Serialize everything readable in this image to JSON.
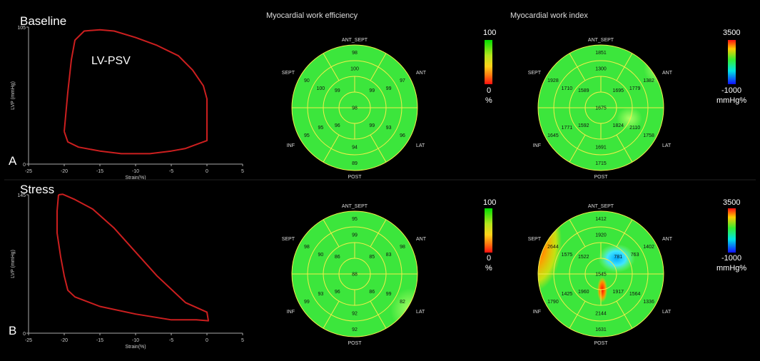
{
  "rows": [
    {
      "row_label": "A",
      "title": "Baseline",
      "annotation": "LV-PSV"
    },
    {
      "row_label": "B",
      "title": "Stress",
      "annotation": ""
    }
  ],
  "column_titles": {
    "efficiency": "Myocardial work efficiency",
    "index": "Myocardial work index"
  },
  "segment_labels": {
    "top": "ANT_SEPT",
    "upper_left": "SEPT",
    "upper_right": "ANT",
    "lower_left": "INF",
    "lower_right": "LAT",
    "bottom": "POST"
  },
  "scales": {
    "efficiency": {
      "max": "100",
      "min": "0",
      "unit": "%"
    },
    "index": {
      "max": "3500",
      "min": "-1000",
      "unit": "mmHg%"
    }
  },
  "colors": {
    "background": "#000000",
    "loop": "#cc1f1f",
    "bullseye_green": "#3ce63c",
    "bullseye_lines": "#f2ee4a",
    "axis": "#aaaaaa"
  },
  "chart_data": [
    {
      "type": "line",
      "panel": "A",
      "title": "Baseline",
      "xlabel": "Strain(%)",
      "ylabel": "LVP (mmHg)",
      "xlim": [
        -25,
        5
      ],
      "ylim": [
        0,
        105
      ],
      "xticks": [
        "-25",
        "-20",
        "-15",
        "-10",
        "-5",
        "0",
        "5"
      ],
      "yticks": [
        "0",
        "105"
      ],
      "series": [
        {
          "points": [
            [
              -20,
              25
            ],
            [
              -19.5,
              55
            ],
            [
              -19,
              80
            ],
            [
              -18.5,
              95
            ],
            [
              -17.2,
              102
            ],
            [
              -15,
              103
            ],
            [
              -13,
              102
            ],
            [
              -10,
              97
            ],
            [
              -7,
              91
            ],
            [
              -4,
              83
            ],
            [
              -2,
              72
            ],
            [
              -0.5,
              60
            ],
            [
              0,
              50
            ],
            [
              0,
              30
            ],
            [
              0,
              18
            ],
            [
              -1,
              16
            ],
            [
              -3,
              12
            ],
            [
              -5,
              10
            ],
            [
              -8,
              8
            ],
            [
              -12,
              8
            ],
            [
              -15,
              10
            ],
            [
              -18,
              13
            ],
            [
              -19.5,
              17
            ],
            [
              -20,
              25
            ]
          ]
        }
      ]
    },
    {
      "type": "line",
      "panel": "B",
      "title": "Stress",
      "xlabel": "Strain(%)",
      "ylabel": "LVP (mmHg)",
      "xlim": [
        -25,
        5
      ],
      "ylim": [
        0,
        145
      ],
      "xticks": [
        "-25",
        "-20",
        "-15",
        "-10",
        "-5",
        "0",
        "5"
      ],
      "yticks": [
        "0",
        "145"
      ],
      "series": [
        {
          "points": [
            [
              -20.8,
              145
            ],
            [
              -21,
              128
            ],
            [
              -21,
              105
            ],
            [
              -20.5,
              80
            ],
            [
              -20,
              60
            ],
            [
              -19.5,
              45
            ],
            [
              -18.5,
              38
            ],
            [
              -15,
              28
            ],
            [
              -10,
              20
            ],
            [
              -5,
              14
            ],
            [
              -1.5,
              14
            ],
            [
              0.2,
              13
            ],
            [
              0,
              22
            ],
            [
              -3,
              32
            ],
            [
              -7,
              60
            ],
            [
              -10,
              85
            ],
            [
              -13,
              110
            ],
            [
              -16,
              130
            ],
            [
              -18.5,
              140
            ],
            [
              -20.2,
              145.5
            ],
            [
              -20.8,
              145
            ]
          ]
        }
      ]
    },
    {
      "type": "heatmap",
      "panel": "A",
      "title": "Myocardial work efficiency",
      "unit": "%",
      "segments": {
        "basal": [
          "98",
          "97",
          "96",
          "89",
          "95",
          "90"
        ],
        "mid": [
          "100",
          "99",
          "93",
          "94",
          "95",
          "100"
        ],
        "apical": [
          "99",
          "99",
          "96",
          "99"
        ],
        "apex": "98"
      }
    },
    {
      "type": "heatmap",
      "panel": "A",
      "title": "Myocardial work index",
      "unit": "mmHg%",
      "segments": {
        "basal": [
          "1851",
          "1382",
          "1758",
          "1715",
          "1645",
          "1928"
        ],
        "mid": [
          "1300",
          "1779",
          "2110",
          "1691",
          "1771",
          "1710"
        ],
        "apical": [
          "1695",
          "1824",
          "1592",
          "1589"
        ],
        "apex": "1675"
      }
    },
    {
      "type": "heatmap",
      "panel": "B",
      "title": "Myocardial work efficiency",
      "unit": "%",
      "segments": {
        "basal": [
          "95",
          "98",
          "82",
          "92",
          "99",
          "98"
        ],
        "mid": [
          "99",
          "83",
          "99",
          "92",
          "93",
          "90"
        ],
        "apical": [
          "85",
          "86",
          "96",
          "86"
        ],
        "apex": "88"
      }
    },
    {
      "type": "heatmap",
      "panel": "B",
      "title": "Myocardial work index",
      "unit": "mmHg%",
      "segments": {
        "basal": [
          "1412",
          "1402",
          "1336",
          "1631",
          "1790",
          "2644"
        ],
        "mid": [
          "1920",
          "763",
          "1564",
          "2144",
          "1425",
          "1575"
        ],
        "apical": [
          "781",
          "1917",
          "1960",
          "1522"
        ],
        "apex": "1545"
      }
    }
  ]
}
